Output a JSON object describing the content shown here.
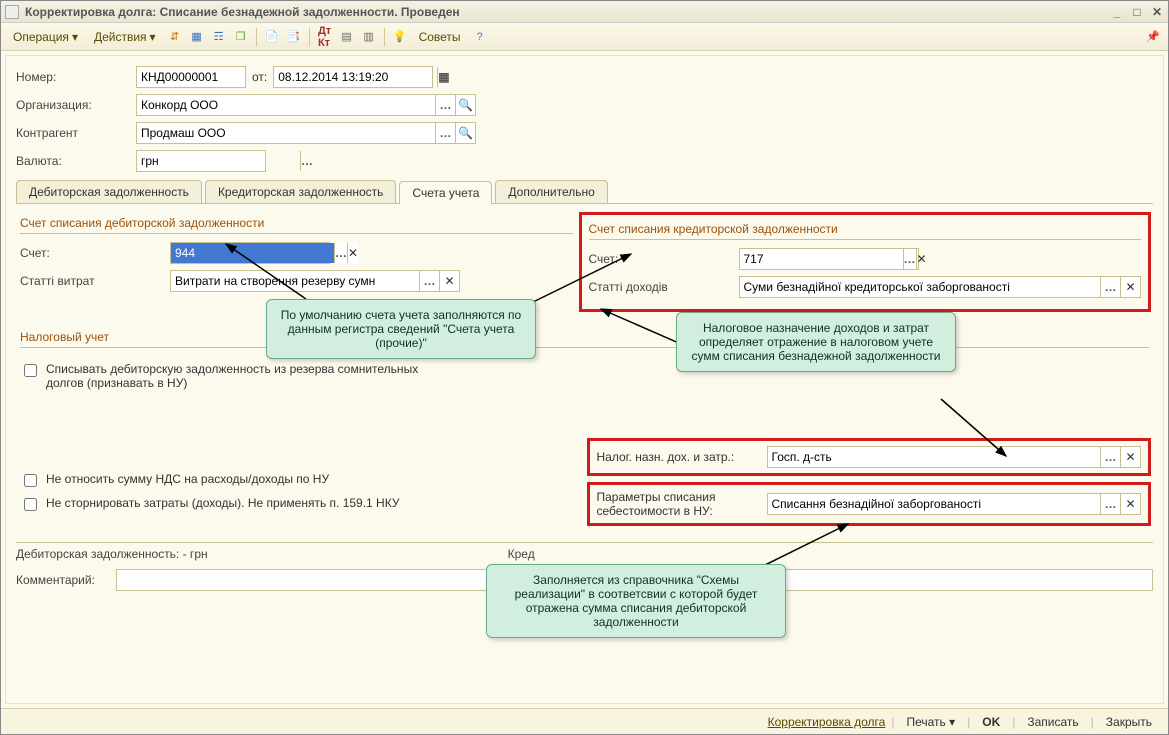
{
  "window": {
    "title": "Корректировка долга: Списание безнадежной задолженности. Проведен"
  },
  "toolbar": {
    "operation": "Операция",
    "actions": "Действия",
    "tips": "Советы"
  },
  "header": {
    "number_label": "Номер:",
    "number": "КНД00000001",
    "from_label": "от:",
    "date": "08.12.2014 13:19:20",
    "org_label": "Организация:",
    "org": "Конкорд ООО",
    "counter_label": "Контрагент",
    "counter": "Продмаш ООО",
    "currency_label": "Валюта:",
    "currency": "грн"
  },
  "tabs": {
    "t1": "Дебиторская задолженность",
    "t2": "Кредиторская задолженность",
    "t3": "Счета учета",
    "t4": "Дополнительно"
  },
  "deb": {
    "group": "Счет списания дебиторской задолженности",
    "acc_label": "Счет:",
    "acc": "944",
    "stat_label": "Статті витрат",
    "stat": "Витрати на створення резерву сумн"
  },
  "kred": {
    "group": "Счет списания кредиторской задолженности",
    "acc_label": "Счет:",
    "acc": "717",
    "stat_label": "Статті доходів",
    "stat": "Суми безнадійної кредиторської заборгованості"
  },
  "tax": {
    "group": "Налоговый учет",
    "chk1": "Списывать дебиторскую задолженность из резерва сомнительных долгов (признавать в НУ)",
    "chk2": "Не относить сумму НДС на расходы/доходы по НУ",
    "chk3": "Не сторнировать затраты (доходы). Не применять п. 159.1 НКУ",
    "nazn_label": "Налог. назн. дох. и затр.:",
    "nazn": "Госп. д-сть",
    "param_label": "Параметры списания себестоимости в НУ:",
    "param": "Списання безнадійної заборгованості"
  },
  "callouts": {
    "c1": "По умолчанию счета учета заполняются по данным регистра сведений \"Счета учета (прочие)\"",
    "c2": "Налоговое назначение доходов и затрат определяет отражение в налоговом учете сумм списания безнадежной задолженности",
    "c3": "Заполняется из справочника \"Схемы реализации\" в соответсвии с которой будет отражена сумма списания дебиторской задолженности"
  },
  "footer": {
    "deb": "Дебиторская задолженность: - грн",
    "kred_label": "Кред",
    "comment_label": "Комментарий:"
  },
  "bottom": {
    "link": "Корректировка долга",
    "print": "Печать",
    "ok": "OK",
    "save": "Записать",
    "close": "Закрыть"
  }
}
